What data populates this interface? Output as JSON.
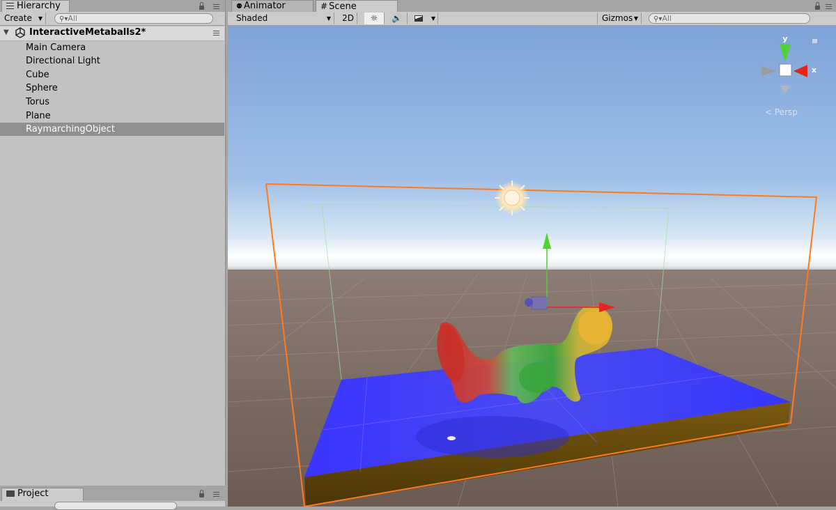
{
  "hierarchy": {
    "tab_label": "Hierarchy",
    "create_label": "Create",
    "search_placeholder": "All",
    "scene_name": "InteractiveMetaballs2*",
    "items": [
      {
        "label": "Main Camera"
      },
      {
        "label": "Directional Light"
      },
      {
        "label": "Cube"
      },
      {
        "label": "Sphere"
      },
      {
        "label": "Torus"
      },
      {
        "label": "Plane"
      },
      {
        "label": "RaymarchingObject",
        "selected": true
      }
    ]
  },
  "project": {
    "tab_label": "Project"
  },
  "scene_view": {
    "tabs": [
      {
        "label": "Animator",
        "active": false,
        "icon": "animator-icon"
      },
      {
        "label": "Scene",
        "active": true,
        "icon": "scene-grid-icon"
      }
    ],
    "shading_mode": "Shaded",
    "mode_2d_label": "2D",
    "gizmos_label": "Gizmos",
    "search_placeholder": "All",
    "gizmo_axes": {
      "y": "y",
      "x": "x"
    },
    "projection_label": "Persp",
    "colors": {
      "selection_outline": "#ff7a1a",
      "plane": "#2f2fff",
      "axis_y": "#52d134",
      "axis_x": "#e3261b",
      "metaball_red": "#c9302a",
      "metaball_green": "#4fb34a",
      "metaball_yellow": "#e8b331"
    }
  }
}
